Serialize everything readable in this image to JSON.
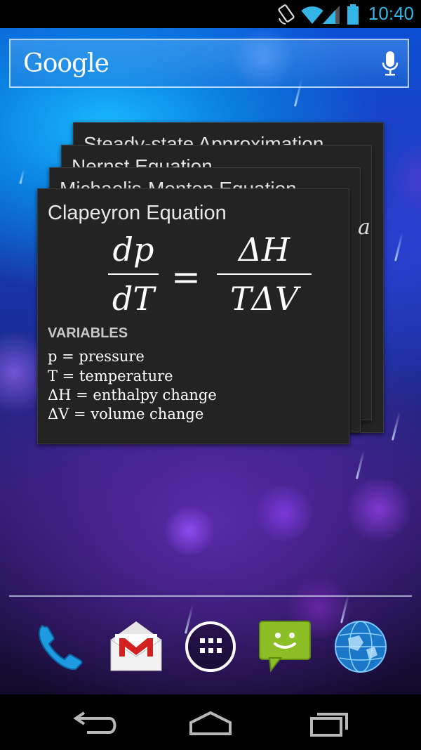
{
  "status": {
    "time": "10:40"
  },
  "search": {
    "logo": "Google"
  },
  "widget": {
    "cards_behind": [
      {
        "title": "Steady-state Approximation"
      },
      {
        "title": "Nernst Equation"
      },
      {
        "title": "Michaelis-Menten Equation"
      }
    ],
    "behind_symbol": "a",
    "main": {
      "title": "Clapeyron Equation",
      "equation": {
        "lhs_num": "dp",
        "lhs_den": "dT",
        "equals": "=",
        "rhs_num": "ΔH",
        "rhs_den": "TΔV"
      },
      "variables_heading": "VARIABLES",
      "variables": [
        "p = pressure",
        "T = temperature",
        "ΔH = enthalpy change",
        "ΔV = volume change"
      ]
    }
  },
  "dock": {
    "apps": [
      {
        "name": "Phone",
        "icon": "phone-icon"
      },
      {
        "name": "Gmail",
        "icon": "gmail-icon"
      },
      {
        "name": "All apps",
        "icon": "apps-grid-icon"
      },
      {
        "name": "Messaging",
        "icon": "messaging-icon"
      },
      {
        "name": "Browser",
        "icon": "globe-icon"
      }
    ]
  },
  "colors": {
    "accent": "#33b5e5",
    "card_bg": "#232323",
    "messaging_green": "#8cbf26",
    "gmail_red": "#d3211f"
  }
}
